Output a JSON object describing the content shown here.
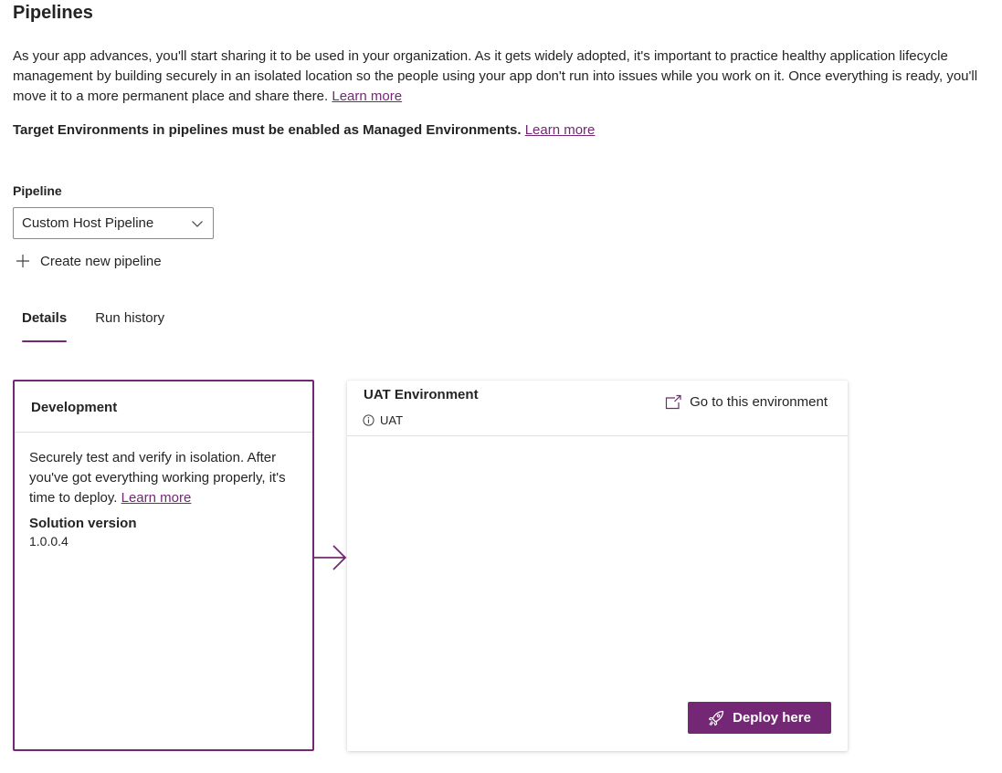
{
  "page": {
    "title": "Pipelines",
    "intro_text": "As your app advances, you'll start sharing it to be used in your organization. As it gets widely adopted, it's important to practice healthy application lifecycle management by building securely in an isolated location so the people using your app don't run into issues while you work on it. Once everything is ready, you'll move it to a more permanent place and share there.",
    "intro_link": "Learn more",
    "managed_note": "Target Environments in pipelines must be enabled as Managed Environments.",
    "managed_link": "Learn more"
  },
  "pipeline": {
    "label": "Pipeline",
    "selected": "Custom Host Pipeline",
    "create_label": "Create new pipeline"
  },
  "tabs": [
    {
      "label": "Details",
      "active": true
    },
    {
      "label": "Run history",
      "active": false
    }
  ],
  "stages": {
    "development": {
      "title": "Development",
      "description": "Securely test and verify in isolation. After you've got everything working properly, it's time to deploy.",
      "link": "Learn more",
      "version_label": "Solution version",
      "version_value": "1.0.0.4"
    },
    "uat": {
      "title": "UAT Environment",
      "subtitle": "UAT",
      "goto_label": "Go to this environment",
      "deploy_label": "Deploy here"
    }
  },
  "icons": {
    "dropdown": "chevron-down-icon",
    "create": "add-icon",
    "arrow": "arrow-right-icon",
    "info": "info-icon",
    "goto": "open-external-icon",
    "deploy": "rocket-icon"
  },
  "colors": {
    "accent": "#742774",
    "text": "#242424",
    "divider": "#e1dfdd"
  }
}
